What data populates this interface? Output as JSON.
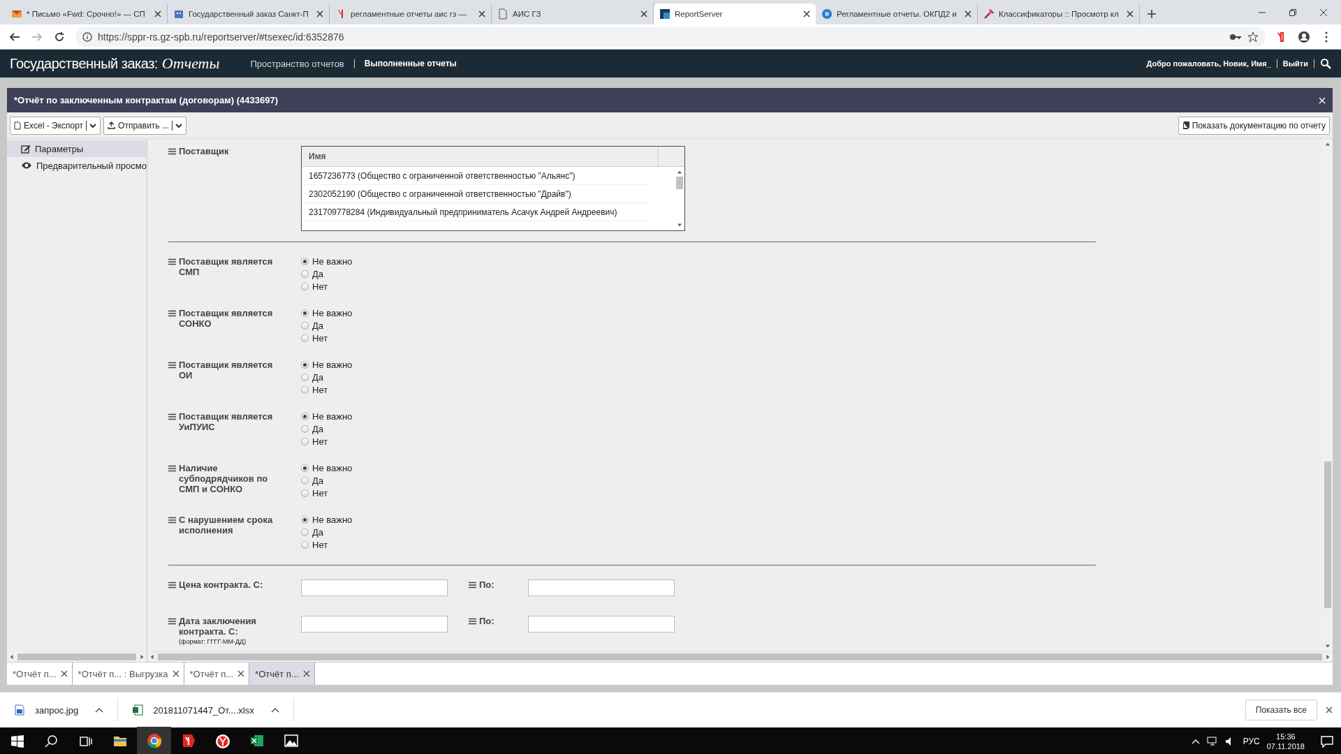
{
  "browser": {
    "tabs": [
      {
        "title": "* Письмо «Fwd: Срочно!» — СП",
        "selected": false
      },
      {
        "title": "Государственный заказ Санкт-П",
        "selected": false
      },
      {
        "title": "регламентные отчеты аис гз —",
        "selected": false
      },
      {
        "title": "АИС ГЗ",
        "selected": false
      },
      {
        "title": "ReportServer",
        "selected": true
      },
      {
        "title": "Регламентные отчеты. ОКПД2 и",
        "selected": false
      },
      {
        "title": "Классификаторы :: Просмотр кл",
        "selected": false
      }
    ],
    "url": "https://sppr-rs.gz-spb.ru/reportserver/#tsexec/id:6352876"
  },
  "header": {
    "brand": "Государственный заказ:",
    "brand_script": "Отчеты",
    "nav": [
      {
        "label": "Пространство отчетов",
        "selected": false
      },
      {
        "label": "Выполненные отчеты",
        "selected": true
      }
    ],
    "welcome": "Добро пожаловать, Новик, Имя_",
    "logout": "Выйти"
  },
  "report": {
    "title": "*Отчёт по заключенным контрактам (договорам) (4433697)",
    "toolbar": [
      "Excel - Экспорт",
      "Отправить ..."
    ],
    "doc_button": "Показать документацию по отчету"
  },
  "sidebar": {
    "items": [
      {
        "label": "Параметры",
        "selected": true
      },
      {
        "label": "Предварительный просмо",
        "selected": false
      }
    ]
  },
  "supplier": {
    "label": "Поставщик",
    "column": "Имя",
    "rows": [
      "1657236773 (Общество с ограниченной ответственностью \"Альянс\")",
      "2302052190 (Общество с ограниченной ответственностью \"Драйв\")",
      "231709778284 (Индивидуальный предприниматель Асачук Андрей Андреевич)"
    ]
  },
  "radio_groups": [
    {
      "label": "Поставщик является СМП",
      "options": [
        {
          "label": "Не важно",
          "selected": true
        },
        {
          "label": "Да",
          "selected": false
        },
        {
          "label": "Нет",
          "selected": false
        }
      ]
    },
    {
      "label": "Поставщик является СОНКО",
      "options": [
        {
          "label": "Не важно",
          "selected": true
        },
        {
          "label": "Да",
          "selected": false
        },
        {
          "label": "Нет",
          "selected": false
        }
      ]
    },
    {
      "label": "Поставщик является ОИ",
      "options": [
        {
          "label": "Не важно",
          "selected": true
        },
        {
          "label": "Да",
          "selected": false
        },
        {
          "label": "Нет",
          "selected": false
        }
      ]
    },
    {
      "label": "Поставщик является УиПУИС",
      "options": [
        {
          "label": "Не важно",
          "selected": true
        },
        {
          "label": "Да",
          "selected": false
        },
        {
          "label": "Нет",
          "selected": false
        }
      ]
    },
    {
      "label": "Наличие субподрядчиков по СМП и СОНКО",
      "options": [
        {
          "label": "Не важно",
          "selected": true
        },
        {
          "label": "Да",
          "selected": false
        },
        {
          "label": "Нет",
          "selected": false
        }
      ]
    },
    {
      "label": "С нарушением срока исполнения",
      "options": [
        {
          "label": "Не важно",
          "selected": true
        },
        {
          "label": "Да",
          "selected": false
        },
        {
          "label": "Нет",
          "selected": false
        }
      ]
    }
  ],
  "ranges": [
    {
      "label": "Цена контракта. С:",
      "to_label": "По:"
    },
    {
      "label": "Дата заключения контракта. С:",
      "note": "(формат: ГГГГ-ММ-ДД)",
      "to_label": "По:"
    }
  ],
  "bottom_tabs": [
    {
      "label": "*Отчёт п...",
      "selected": false
    },
    {
      "label": "*Отчёт п... : Выгрузка",
      "selected": false
    },
    {
      "label": "*Отчёт п...",
      "selected": false
    },
    {
      "label": "*Отчёт п...",
      "selected": true
    }
  ],
  "downloads": {
    "files": [
      {
        "name": "запрос.jpg"
      },
      {
        "name": "201811071447_От....xlsx"
      }
    ],
    "show_all": "Показать все"
  },
  "taskbar": {
    "lang": "РУС",
    "time": "15:36",
    "date": "07.11.2018"
  }
}
